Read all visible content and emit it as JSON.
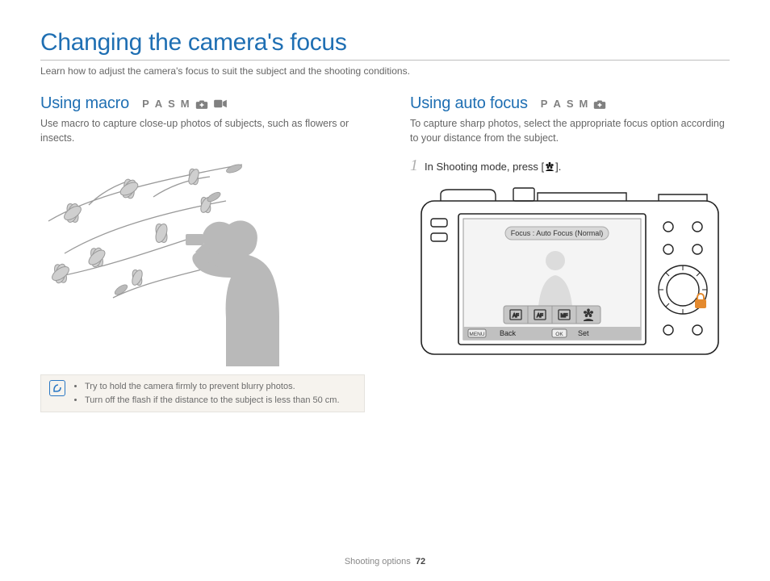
{
  "title": "Changing the camera's focus",
  "intro": "Learn how to adjust the camera's focus to suit the subject and the shooting conditions.",
  "left": {
    "heading": "Using macro",
    "modes": [
      "P",
      "A",
      "S",
      "M"
    ],
    "body": "Use macro to capture close-up photos of subjects, such as flowers or insects.",
    "note1": "Try to hold the camera firmly to prevent blurry photos.",
    "note2": "Turn off the flash if the distance to the subject is less than 50 cm."
  },
  "right": {
    "heading": "Using auto focus",
    "modes": [
      "P",
      "A",
      "S",
      "M"
    ],
    "body": "To capture sharp photos, select the appropriate focus option according to your distance from the subject.",
    "step1_num": "1",
    "step1_a": "In Shooting mode, press [",
    "step1_b": "].",
    "screen": {
      "label": "Focus : Auto Focus (Normal)",
      "back_btn": "MENU",
      "back": "Back",
      "set_btn": "OK",
      "set": "Set"
    }
  },
  "footer": {
    "section": "Shooting options",
    "page": "72"
  }
}
